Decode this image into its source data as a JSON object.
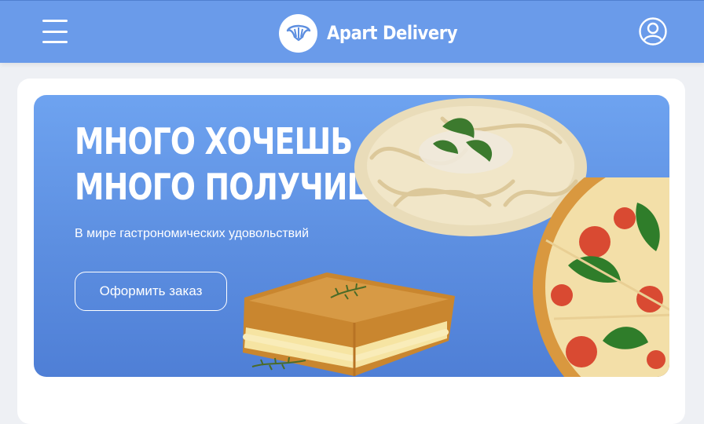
{
  "header": {
    "brand_name": "Apart Delivery",
    "menu_icon": "hamburger-menu-icon",
    "logo_icon": "croissant-icon",
    "user_icon": "user-profile-icon"
  },
  "hero": {
    "title_line1": "МНОГО ХОЧЕШЬ —",
    "title_line2": "МНОГО ПОЛУЧИШЬ",
    "subtitle": "В мире гастрономических удовольствий",
    "cta_label": "Оформить заказ",
    "images": [
      "pasta-dish",
      "pizza",
      "grilled-cheese-sandwich"
    ]
  },
  "colors": {
    "header_bg": "#6a9bea",
    "hero_bg": "#5c8ee0",
    "text": "#ffffff"
  }
}
